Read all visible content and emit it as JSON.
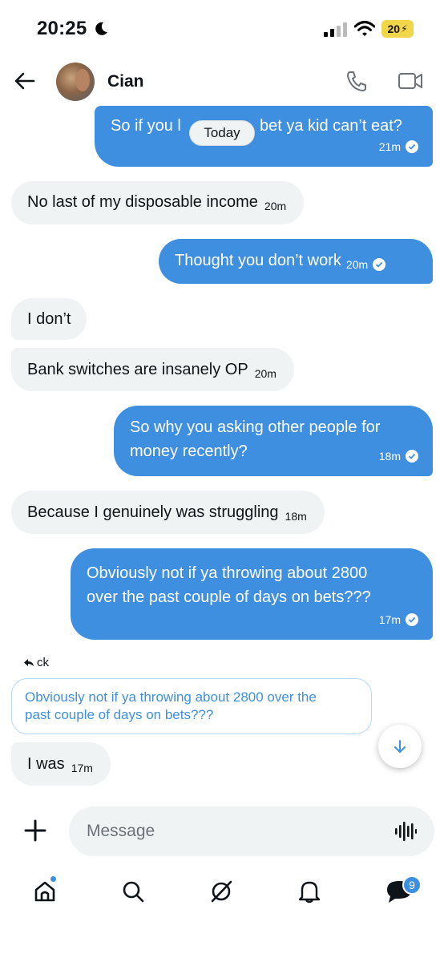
{
  "status_bar": {
    "time": "20:25",
    "battery": "20"
  },
  "header": {
    "contact_name": "Cian"
  },
  "date_separator": "Today",
  "messages": [
    {
      "direction": "out",
      "text": "So if you l",
      "text_tail": "bet ya kid can’t eat?",
      "time": "21m"
    },
    {
      "direction": "in",
      "text": "No last of my disposable income",
      "time": "20m"
    },
    {
      "direction": "out",
      "text": "Thought you don’t work",
      "time": "20m"
    },
    {
      "direction": "in",
      "text": "I don’t"
    },
    {
      "direction": "in",
      "text": "Bank switches are insanely OP",
      "time": "20m"
    },
    {
      "direction": "out",
      "line1": "So why you asking other people for",
      "line2": "money recently?",
      "time": "18m"
    },
    {
      "direction": "in",
      "text": "Because I genuinely was struggling",
      "time": "18m"
    },
    {
      "direction": "out",
      "line1": "Obviously not if ya throwing about 2800",
      "line2": "over the past couple of days on bets???",
      "time": "17m"
    },
    {
      "direction": "in",
      "text": "I was",
      "time": "17m"
    }
  ],
  "reply": {
    "label": "ck",
    "quote_line1": "Obviously not if ya throwing about 2800 over the",
    "quote_line2": "past couple of days on bets???"
  },
  "composer": {
    "placeholder": "Message"
  },
  "nav": {
    "messages_badge": "9"
  },
  "colors": {
    "accent": "#3f8fe0",
    "incoming_bubble": "#eff3f4"
  }
}
